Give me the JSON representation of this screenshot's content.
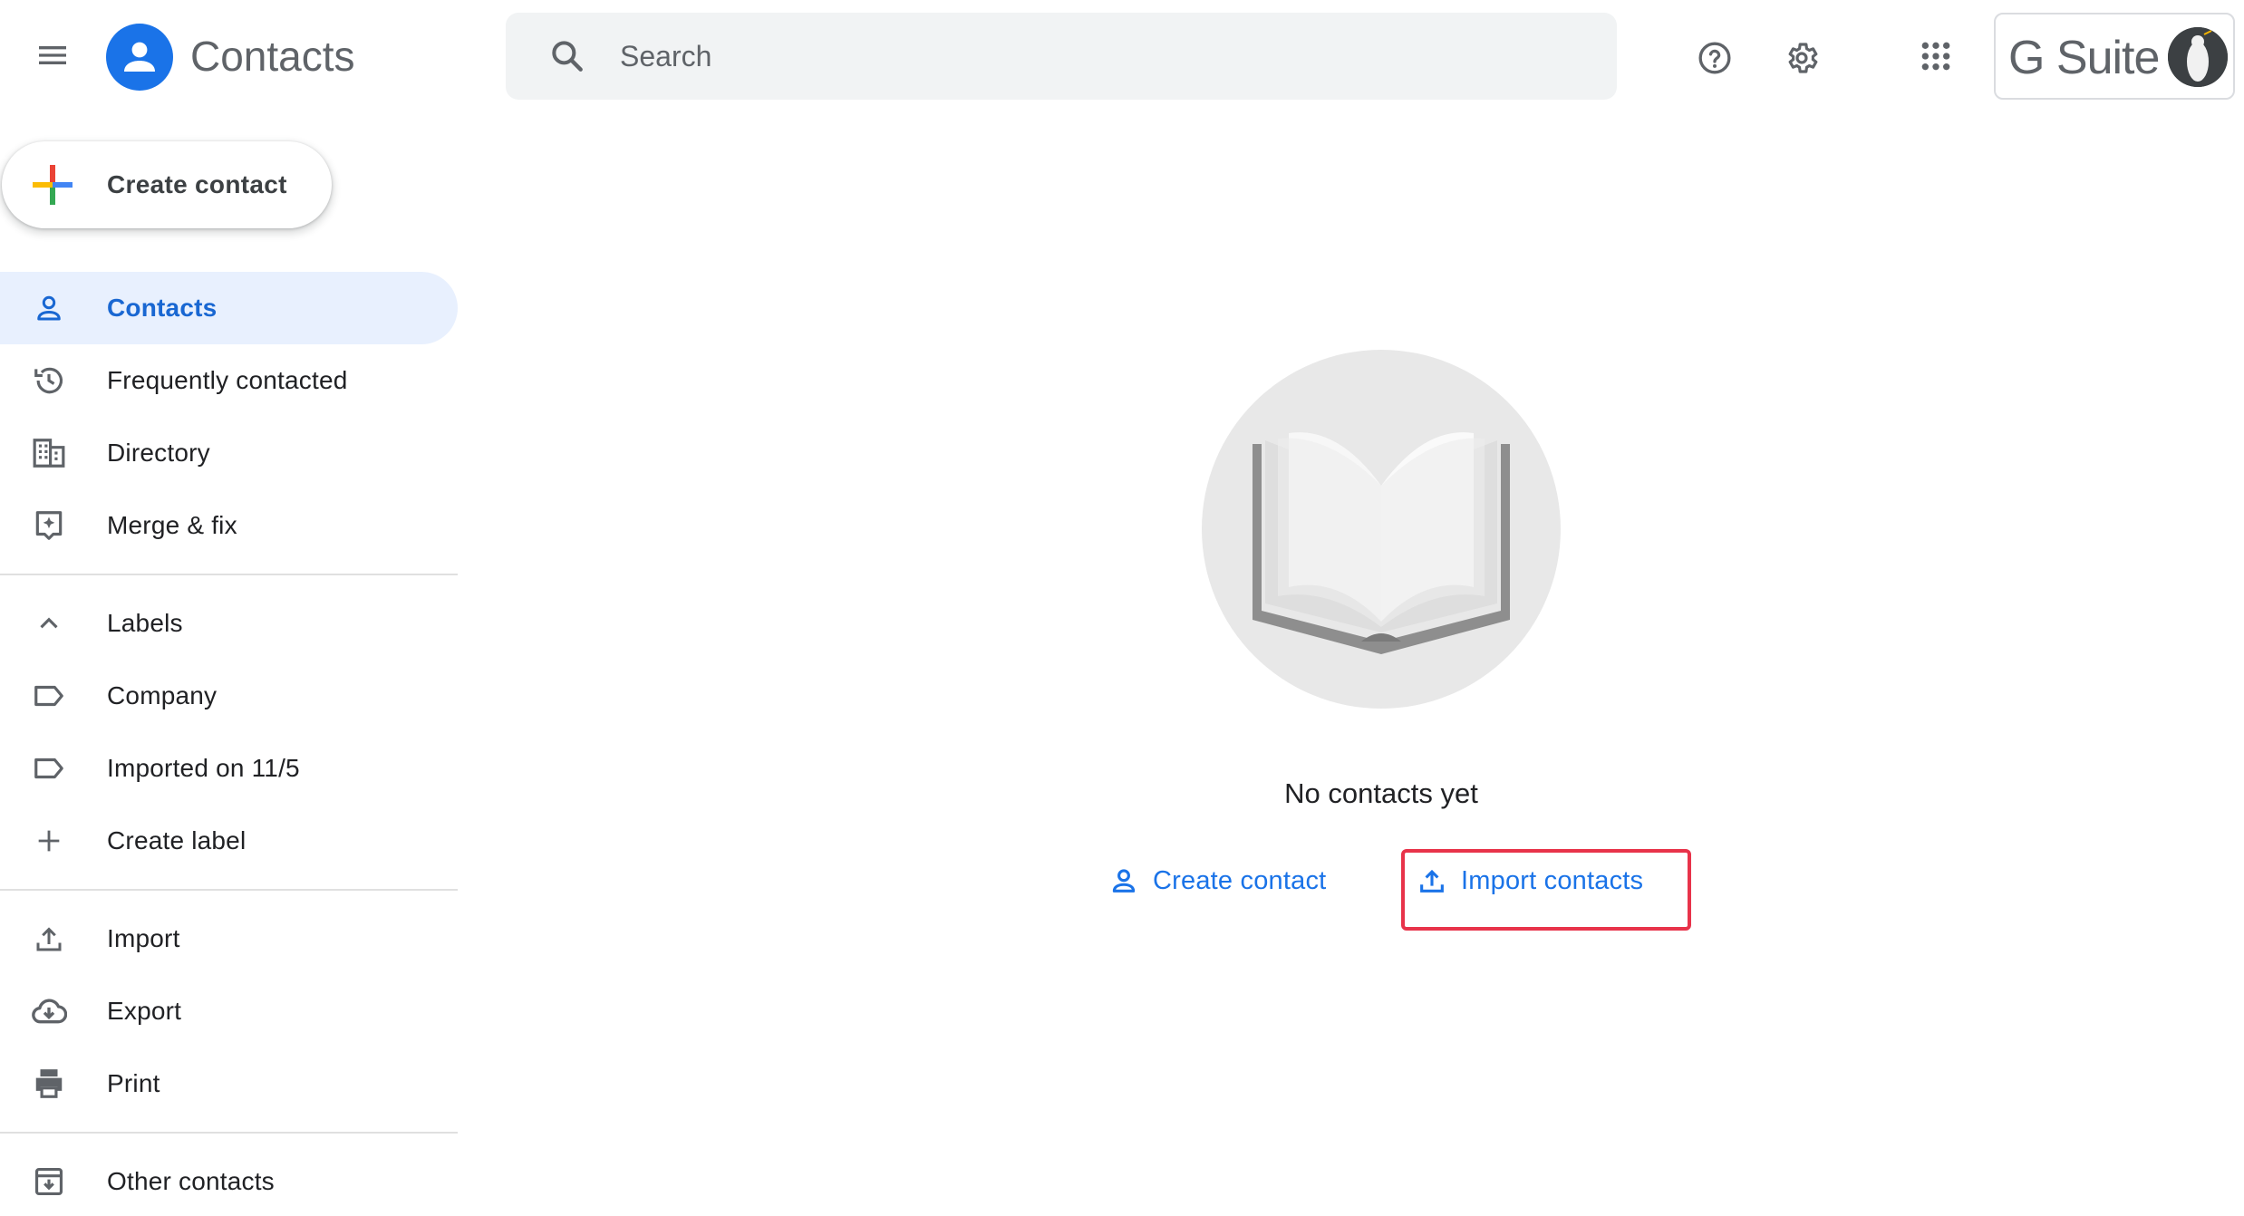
{
  "header": {
    "app_title": "Contacts",
    "search_placeholder": "Search",
    "brand_text": "G Suite",
    "icons": {
      "menu": "hamburger-menu-icon",
      "logo": "contacts-person-icon",
      "search": "search-icon",
      "help": "help-circle-icon",
      "settings": "gear-icon",
      "apps": "apps-grid-icon"
    }
  },
  "sidebar": {
    "create_label": "Create contact",
    "items": [
      {
        "label": "Contacts",
        "icon": "person-icon",
        "active": true
      },
      {
        "label": "Frequently contacted",
        "icon": "history-icon"
      },
      {
        "label": "Directory",
        "icon": "building-icon"
      },
      {
        "label": "Merge & fix",
        "icon": "merge-fix-icon"
      }
    ],
    "labels_section": {
      "title": "Labels",
      "items": [
        {
          "label": "Company",
          "icon": "label-icon"
        },
        {
          "label": "Imported on 11/5",
          "icon": "label-icon"
        },
        {
          "label": "Create label",
          "icon": "plus-icon"
        }
      ]
    },
    "tools": [
      {
        "label": "Import",
        "icon": "upload-icon"
      },
      {
        "label": "Export",
        "icon": "cloud-download-icon"
      },
      {
        "label": "Print",
        "icon": "printer-icon"
      }
    ],
    "other": {
      "label": "Other contacts",
      "icon": "archive-icon"
    }
  },
  "main": {
    "empty_message": "No contacts yet",
    "create_action": "Create contact",
    "import_action": "Import contacts"
  },
  "colors": {
    "accent": "#1a73e8",
    "active_bg": "#e8f0fe",
    "highlight": "#e8334a"
  }
}
